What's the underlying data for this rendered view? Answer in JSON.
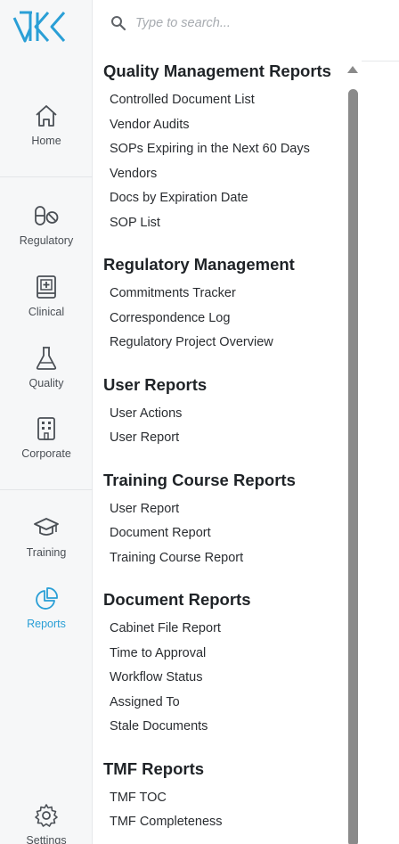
{
  "brand": {
    "accent": "#2a9fd6",
    "logo_icon": "kk-logo-icon"
  },
  "search": {
    "placeholder": "Type to search...",
    "value": ""
  },
  "nav": {
    "home": "Home",
    "regulatory": "Regulatory",
    "clinical": "Clinical",
    "quality": "Quality",
    "corporate": "Corporate",
    "training": "Training",
    "reports": "Reports",
    "settings": "Settings",
    "active": "reports"
  },
  "sections": [
    {
      "title": "Quality Management Reports",
      "items": [
        "Controlled Document List",
        "Vendor Audits",
        "SOPs Expiring in the Next 60 Days",
        "Vendors",
        "Docs by Expiration Date",
        "SOP List"
      ]
    },
    {
      "title": "Regulatory Management",
      "items": [
        "Commitments Tracker",
        "Correspondence Log",
        "Regulatory Project Overview"
      ]
    },
    {
      "title": "User Reports",
      "items": [
        "User Actions",
        "User Report"
      ]
    },
    {
      "title": "Training Course Reports",
      "items": [
        "User Report",
        "Document Report",
        "Training Course Report"
      ]
    },
    {
      "title": "Document Reports",
      "items": [
        "Cabinet File Report",
        "Time to Approval",
        "Workflow Status",
        "Assigned To",
        "Stale Documents"
      ]
    },
    {
      "title": "TMF Reports",
      "items": [
        "TMF TOC",
        "TMF Completeness"
      ]
    }
  ]
}
